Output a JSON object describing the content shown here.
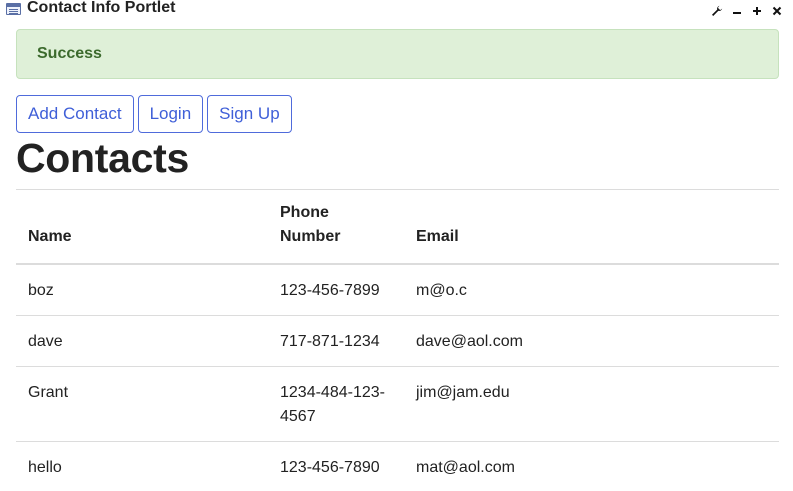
{
  "portlet": {
    "title": "Contact Info Portlet",
    "controls": [
      "wrench-icon",
      "minimize-icon",
      "maximize-icon",
      "close-icon"
    ]
  },
  "alert": {
    "text": "Success",
    "color": "#dff0d8"
  },
  "toolbar": {
    "add_contact_label": "Add Contact",
    "login_label": "Login",
    "sign_up_label": "Sign Up",
    "accent": "#3f5fd8"
  },
  "page": {
    "title": "Contacts"
  },
  "table": {
    "headers": {
      "name": "Name",
      "phone_line1": "Phone",
      "phone_line2": "Number",
      "email": "Email"
    },
    "rows": [
      {
        "name": "boz",
        "phone": "123-456-7899",
        "email": "m@o.c"
      },
      {
        "name": "dave",
        "phone": "717-871-1234",
        "email": "dave@aol.com"
      },
      {
        "name": "Grant",
        "phone_line1": "1234-484-123-",
        "phone_line2": "4567",
        "email": "jim@jam.edu"
      },
      {
        "name": "hello",
        "phone": "123-456-7890",
        "email": "mat@aol.com"
      }
    ]
  }
}
